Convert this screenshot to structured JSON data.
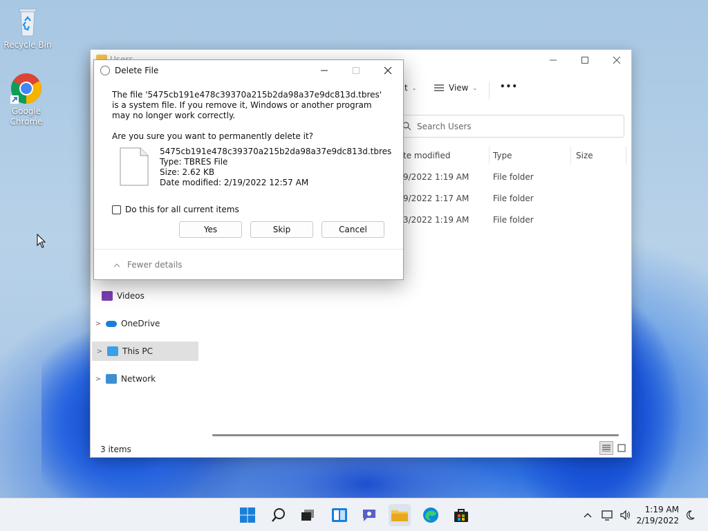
{
  "desktop": {
    "icons": [
      {
        "label": "Recycle Bin"
      },
      {
        "label": "Google Chrome"
      }
    ]
  },
  "explorer": {
    "title": "Users",
    "toolbar": {
      "sort_label": "t",
      "view_label": "View",
      "more_label": "•••"
    },
    "search_placeholder": "Search Users",
    "columns": [
      "te modified",
      "Type",
      "Size"
    ],
    "rows": [
      {
        "date": "9/2022 1:19 AM",
        "type": "File folder"
      },
      {
        "date": "9/2022 1:17 AM",
        "type": "File folder"
      },
      {
        "date": "3/2022 1:19 AM",
        "type": "File folder"
      }
    ],
    "nav": [
      {
        "label": "Videos"
      },
      {
        "label": "OneDrive"
      },
      {
        "label": "This PC"
      },
      {
        "label": "Network"
      }
    ],
    "status": "3 items"
  },
  "dialog": {
    "title": "Delete File",
    "message": "The file '5475cb191e478c39370a215b2da98a37e9dc813d.tbres' is a system file. If you remove it, Windows or another program may no longer work correctly.",
    "question": "Are you sure you want to permanently delete it?",
    "file": {
      "name": "5475cb191e478c39370a215b2da98a37e9dc813d.tbres",
      "type": "Type: TBRES File",
      "size": "Size: 2.62 KB",
      "modified": "Date modified: 2/19/2022 12:57 AM"
    },
    "checkbox_label": "Do this for all current items",
    "buttons": {
      "yes": "Yes",
      "skip": "Skip",
      "cancel": "Cancel"
    },
    "fewer_details": "Fewer details"
  },
  "taskbar": {
    "time": "1:19 AM",
    "date": "2/19/2022"
  },
  "colors": {
    "accent": "#0067c0",
    "folder": "#f3c44e"
  }
}
